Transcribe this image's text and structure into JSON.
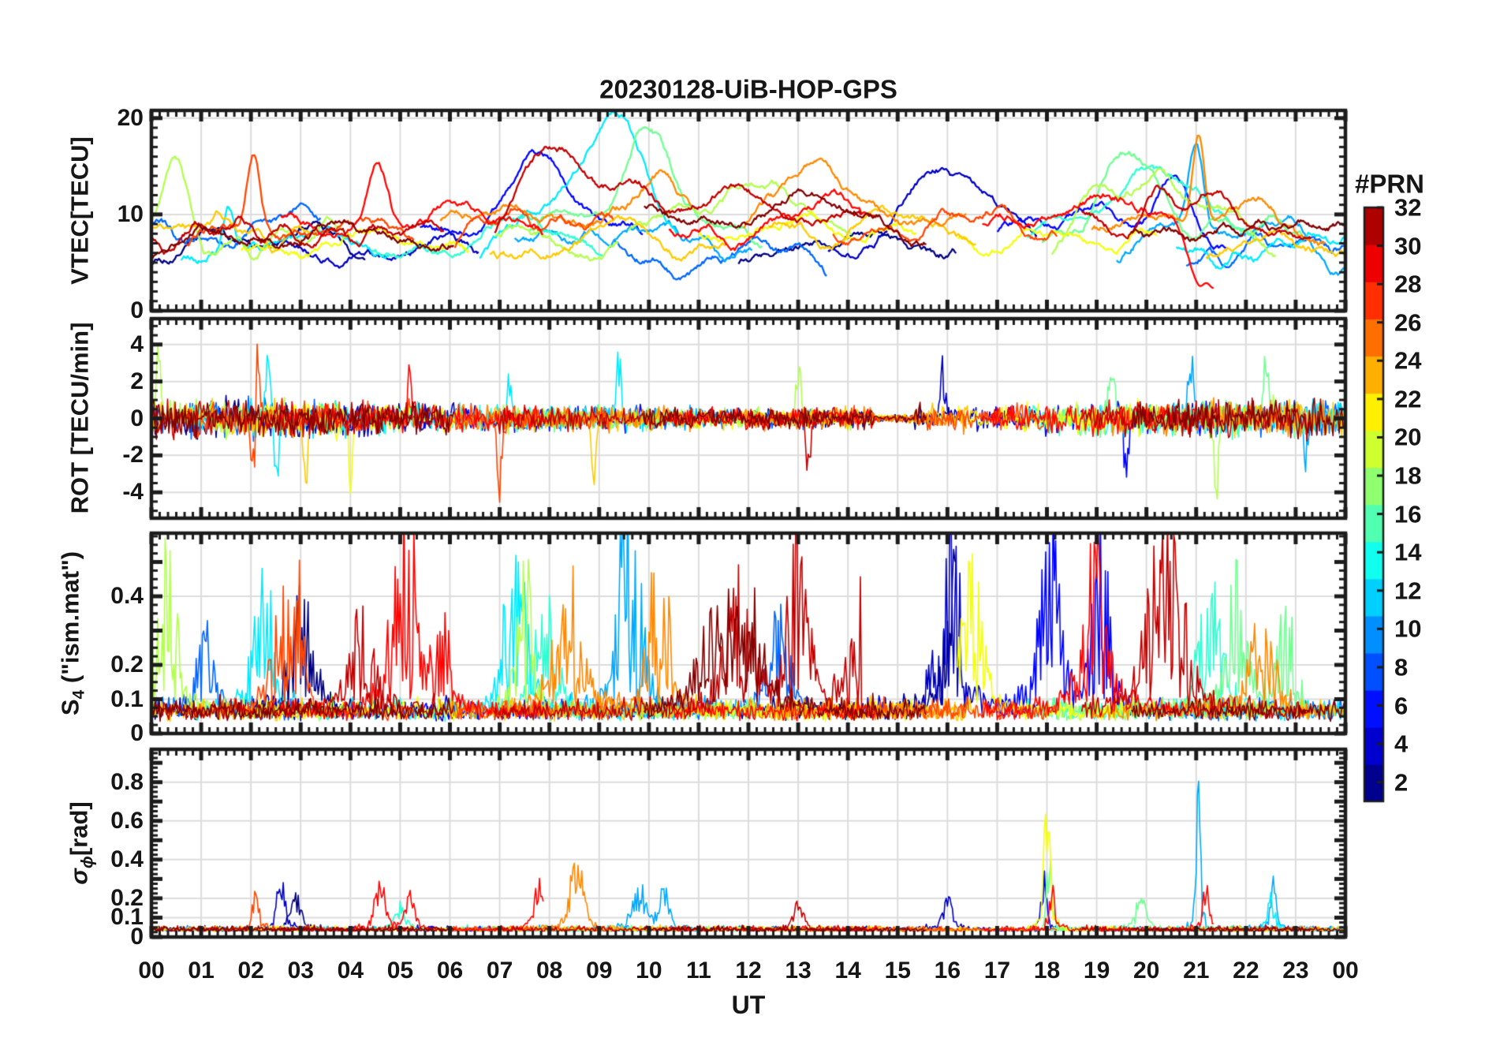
{
  "colorbar": {
    "title": "#PRN",
    "tick_values": [
      2,
      4,
      6,
      8,
      10,
      12,
      14,
      16,
      18,
      20,
      22,
      24,
      26,
      28,
      30,
      32
    ],
    "value_range": [
      1,
      32
    ],
    "segment_colors": [
      "#00008F",
      "#0000CF",
      "#0010FF",
      "#0050FF",
      "#008FFF",
      "#00CFFF",
      "#10FFEF",
      "#50FFAF",
      "#8FFF6F",
      "#CFFF2F",
      "#FFEF00",
      "#FFAF00",
      "#FF6F00",
      "#FF2F00",
      "#EF0000",
      "#AF0000"
    ]
  },
  "chart_data": {
    "type": "line",
    "title": "20230128-UiB-HOP-GPS",
    "xlabel": "UT",
    "colormap": "jet",
    "prn_range": [
      1,
      32
    ],
    "x": {
      "range_hours": [
        0,
        24
      ],
      "tick_values": [
        0,
        1,
        2,
        3,
        4,
        5,
        6,
        7,
        8,
        9,
        10,
        11,
        12,
        13,
        14,
        15,
        16,
        17,
        18,
        19,
        20,
        21,
        22,
        23,
        24
      ],
      "tick_labels": [
        "00",
        "01",
        "02",
        "03",
        "04",
        "05",
        "06",
        "07",
        "08",
        "09",
        "10",
        "11",
        "12",
        "13",
        "14",
        "15",
        "16",
        "17",
        "18",
        "19",
        "20",
        "21",
        "22",
        "23",
        "00"
      ],
      "grid": true,
      "minor_tick_minutes": 10
    },
    "panels": [
      {
        "name": "vtec",
        "ylabel": "VTEC[TECU]",
        "ylim": [
          0,
          20.8
        ],
        "yticks": [
          [
            0,
            "0"
          ],
          [
            10,
            "10"
          ],
          [
            20,
            "20"
          ]
        ],
        "grid_y": [
          10,
          20
        ],
        "minor_step": 1,
        "extra_major": []
      },
      {
        "name": "rot",
        "ylabel": "ROT [TECU/min]",
        "ylim": [
          -5.4,
          5.4
        ],
        "yticks": [
          [
            -4,
            "-4"
          ],
          [
            -2,
            "-2"
          ],
          [
            0,
            "0"
          ],
          [
            2,
            "2"
          ],
          [
            4,
            "4"
          ]
        ],
        "grid_y": [
          -4,
          -2,
          0,
          2,
          4
        ],
        "minor_step": 0.5,
        "extra_major": []
      },
      {
        "name": "s4",
        "ylabel": "S4 (\"ism.mat\")",
        "ylabel_parts": {
          "main": "S",
          "sub": "4",
          "rest": " (\"ism.mat\")"
        },
        "ylim": [
          0,
          0.584
        ],
        "yticks": [
          [
            0,
            "0"
          ],
          [
            0.1,
            "0.1"
          ],
          [
            0.2,
            "0.2"
          ],
          [
            0.4,
            "0.4"
          ]
        ],
        "grid_y": [
          0.1,
          0.2,
          0.4
        ],
        "minor_step": 0.025,
        "extra_major": [
          0.3,
          0.5
        ]
      },
      {
        "name": "sigma_phi",
        "ylabel": "σϕ[rad]",
        "ylabel_parts": {
          "sigma": "σ",
          "sub": "ϕ",
          "rest": "[rad]"
        },
        "ylim": [
          0,
          0.97
        ],
        "yticks": [
          [
            0,
            "0"
          ],
          [
            0.1,
            "0.1"
          ],
          [
            0.2,
            "0.2"
          ],
          [
            0.4,
            "0.4"
          ],
          [
            0.6,
            "0.6"
          ],
          [
            0.8,
            "0.8"
          ]
        ],
        "grid_y": [
          0.1,
          0.2,
          0.4,
          0.6,
          0.8
        ],
        "minor_step": 0.025,
        "extra_major": [
          0.3,
          0.5,
          0.7,
          0.9
        ]
      }
    ],
    "seed": 20230128,
    "passes_format": "[prn, t_start_h, t_end_h, vtec_base_TECU, vtec_arc_amp_TECU]",
    "passes": [
      [
        1,
        0,
        4.3,
        6.5,
        1.0
      ],
      [
        1,
        11.8,
        16.2,
        6.0,
        1.5
      ],
      [
        3,
        2.2,
        6.6,
        5.5,
        1.2
      ],
      [
        3,
        13.6,
        17.8,
        7.0,
        3.0
      ],
      [
        5,
        5.4,
        9.9,
        7.0,
        2.0
      ],
      [
        5,
        17.0,
        21.6,
        7.5,
        3.0
      ],
      [
        8,
        0,
        3.4,
        9.5,
        -1.5
      ],
      [
        8,
        9.3,
        13.6,
        5.5,
        1.0
      ],
      [
        8,
        20.8,
        24,
        6.0,
        0.5
      ],
      [
        10,
        7.3,
        12.1,
        6.5,
        1.5
      ],
      [
        10,
        19.4,
        24,
        7.0,
        1.5
      ],
      [
        12,
        0.6,
        4.8,
        6.0,
        1.0
      ],
      [
        12,
        6.6,
        10.6,
        7.0,
        3.0
      ],
      [
        12,
        20.6,
        24,
        6.5,
        0.8
      ],
      [
        14,
        4.4,
        9.1,
        6.0,
        2.0
      ],
      [
        14,
        17.6,
        22.2,
        7.0,
        3.5
      ],
      [
        16,
        7.6,
        12.3,
        8.0,
        3.0
      ],
      [
        16,
        17.9,
        23.2,
        7.5,
        3.0
      ],
      [
        18,
        0,
        3.9,
        7.0,
        1.5
      ],
      [
        18,
        6.9,
        9.4,
        6.5,
        1.0
      ],
      [
        18,
        9.6,
        14.1,
        8.0,
        3.0
      ],
      [
        18,
        18.1,
        22.6,
        8.0,
        3.0
      ],
      [
        20,
        1.8,
        6.4,
        6.0,
        1.2
      ],
      [
        20,
        11.0,
        15.4,
        7.5,
        1.5
      ],
      [
        20,
        16.2,
        20.2,
        7.0,
        1.0
      ],
      [
        22,
        0,
        3.3,
        7.5,
        0.8
      ],
      [
        22,
        6.8,
        11.6,
        6.0,
        1.5
      ],
      [
        22,
        12.4,
        16.6,
        8.0,
        1.2
      ],
      [
        22,
        21.2,
        24,
        7.0,
        0.5
      ],
      [
        24,
        5.8,
        10.9,
        8.0,
        3.0
      ],
      [
        24,
        11.9,
        16.4,
        8.5,
        2.0
      ],
      [
        24,
        18.9,
        23.6,
        8.0,
        2.5
      ],
      [
        26,
        0.7,
        5.3,
        7.0,
        1.5
      ],
      [
        26,
        6.1,
        9.3,
        7.5,
        2.0
      ],
      [
        26,
        13.7,
        18.2,
        8.0,
        1.5
      ],
      [
        28,
        2.6,
        7.9,
        8.0,
        2.0
      ],
      [
        28,
        10.4,
        14.6,
        8.5,
        1.5
      ],
      [
        28,
        16.7,
        21.35,
        9.0,
        2.0
      ],
      [
        30,
        0,
        5.9,
        7.5,
        1.0
      ],
      [
        30,
        6.9,
        14.3,
        9.0,
        3.0
      ],
      [
        30,
        18.7,
        23.3,
        8.0,
        2.5
      ],
      [
        32,
        0,
        6.1,
        7.0,
        1.2
      ],
      [
        32,
        9.9,
        15.6,
        9.0,
        2.0
      ],
      [
        32,
        19.7,
        24,
        8.0,
        1.0
      ]
    ],
    "events": {
      "vtec_peaks_format": "[prn, t_h, peak_TECU, gauss_width_h]",
      "vtec_peaks": [
        [
          22,
          0.2,
          10.0,
          0.3
        ],
        [
          18,
          0.45,
          16.0,
          0.25
        ],
        [
          12,
          1.55,
          10.5,
          0.1
        ],
        [
          26,
          2.05,
          15.8,
          0.12
        ],
        [
          28,
          4.55,
          16.5,
          0.2
        ],
        [
          5,
          7.7,
          17.5,
          0.5
        ],
        [
          30,
          8.3,
          17.8,
          0.45
        ],
        [
          12,
          9.45,
          21.5,
          0.55
        ],
        [
          16,
          9.95,
          17.5,
          0.4
        ],
        [
          24,
          10.3,
          13.2,
          0.35
        ],
        [
          18,
          12.0,
          13.5,
          0.7
        ],
        [
          24,
          13.3,
          13.8,
          0.4
        ],
        [
          3,
          15.8,
          14.5,
          0.45
        ],
        [
          16,
          19.75,
          17.0,
          0.45
        ],
        [
          14,
          19.9,
          15.5,
          0.4
        ],
        [
          18,
          20.15,
          16.2,
          0.35
        ],
        [
          30,
          20.25,
          13.5,
          0.3
        ],
        [
          5,
          20.5,
          14.0,
          0.3
        ],
        [
          10,
          21.0,
          17.5,
          0.15
        ],
        [
          24,
          21.05,
          20.3,
          0.12
        ]
      ],
      "vtec_drops_format": "[prn, t_h, level_TECU]",
      "vtec_drops": [
        [
          28,
          20.85,
          2.6
        ]
      ],
      "rot_spikes_format": "[prn, t_h, amp_TECU_per_min]",
      "rot_spikes": [
        [
          18,
          0.15,
          4.6
        ],
        [
          26,
          2.05,
          -5.2
        ],
        [
          26,
          2.12,
          4.8
        ],
        [
          12,
          2.35,
          4.6
        ],
        [
          12,
          2.5,
          -4.4
        ],
        [
          22,
          3.1,
          -4.0
        ],
        [
          20,
          4.0,
          -4.5
        ],
        [
          28,
          5.2,
          3.5
        ],
        [
          26,
          7.0,
          -5.0
        ],
        [
          12,
          7.2,
          3.8
        ],
        [
          22,
          8.9,
          -4.3
        ],
        [
          12,
          9.4,
          4.2
        ],
        [
          18,
          13.0,
          4.3
        ],
        [
          30,
          13.2,
          -3.8
        ],
        [
          3,
          15.9,
          3.5
        ],
        [
          10,
          17.6,
          4.0
        ],
        [
          16,
          19.3,
          4.5
        ],
        [
          5,
          19.6,
          -4.2
        ],
        [
          10,
          20.9,
          4.7
        ],
        [
          18,
          21.4,
          -4.6
        ],
        [
          16,
          22.4,
          4.4
        ],
        [
          10,
          23.2,
          -3.9
        ]
      ],
      "s4_bursts_format": "[prn, t_h, amp, gauss_width_h]",
      "s4_bursts": [
        [
          18,
          0.3,
          0.45,
          0.2
        ],
        [
          8,
          1.1,
          0.3,
          0.15
        ],
        [
          12,
          2.2,
          0.5,
          0.18
        ],
        [
          26,
          2.6,
          0.4,
          0.2
        ],
        [
          26,
          3.0,
          0.5,
          0.08
        ],
        [
          1,
          3.0,
          0.4,
          0.2
        ],
        [
          30,
          4.2,
          0.3,
          0.25
        ],
        [
          28,
          5.1,
          0.62,
          0.2
        ],
        [
          28,
          5.8,
          0.35,
          0.15
        ],
        [
          12,
          7.3,
          0.6,
          0.18
        ],
        [
          18,
          7.5,
          0.5,
          0.15
        ],
        [
          14,
          7.9,
          0.35,
          0.2
        ],
        [
          24,
          8.4,
          0.45,
          0.25
        ],
        [
          10,
          9.6,
          0.7,
          0.2
        ],
        [
          24,
          10.2,
          0.5,
          0.2
        ],
        [
          32,
          11.3,
          0.3,
          0.3
        ],
        [
          30,
          11.8,
          0.4,
          0.25
        ],
        [
          32,
          12.0,
          0.35,
          0.3
        ],
        [
          8,
          12.6,
          0.3,
          0.2
        ],
        [
          30,
          13.0,
          0.55,
          0.2
        ],
        [
          30,
          14.2,
          0.45,
          0.2
        ],
        [
          3,
          16.0,
          0.62,
          0.2
        ],
        [
          1,
          16.2,
          0.45,
          0.2
        ],
        [
          20,
          16.5,
          0.5,
          0.2
        ],
        [
          10,
          17.3,
          0.55,
          0.2
        ],
        [
          5,
          18.1,
          0.6,
          0.2
        ],
        [
          28,
          19.0,
          0.55,
          0.25
        ],
        [
          5,
          19.1,
          0.55,
          0.15
        ],
        [
          30,
          20.4,
          0.65,
          0.3
        ],
        [
          14,
          21.3,
          0.45,
          0.2
        ],
        [
          16,
          21.8,
          0.4,
          0.2
        ],
        [
          24,
          22.3,
          0.4,
          0.2
        ],
        [
          16,
          22.8,
          0.35,
          0.15
        ]
      ],
      "sigma_phi_spikes_format": "[prn, t_h, amp_rad, gauss_width_h]",
      "sigma_phi_spikes": [
        [
          1,
          2.9,
          0.2,
          0.1
        ],
        [
          3,
          2.6,
          0.28,
          0.08
        ],
        [
          26,
          2.1,
          0.25,
          0.06
        ],
        [
          28,
          4.6,
          0.3,
          0.1
        ],
        [
          14,
          5.0,
          0.15,
          0.1
        ],
        [
          28,
          5.2,
          0.25,
          0.08
        ],
        [
          28,
          7.8,
          0.3,
          0.1
        ],
        [
          24,
          8.55,
          0.42,
          0.12
        ],
        [
          10,
          9.8,
          0.28,
          0.12
        ],
        [
          10,
          10.3,
          0.25,
          0.1
        ],
        [
          30,
          13.0,
          0.15,
          0.1
        ],
        [
          3,
          16.0,
          0.18,
          0.1
        ],
        [
          5,
          17.95,
          0.3,
          0.05
        ],
        [
          20,
          18.0,
          0.9,
          0.05
        ],
        [
          16,
          18.05,
          0.47,
          0.05
        ],
        [
          28,
          18.1,
          0.25,
          0.06
        ],
        [
          16,
          19.9,
          0.2,
          0.1
        ],
        [
          10,
          21.05,
          0.92,
          0.04
        ],
        [
          28,
          21.2,
          0.3,
          0.06
        ],
        [
          12,
          22.5,
          0.25,
          0.06
        ],
        [
          10,
          22.55,
          0.33,
          0.05
        ]
      ]
    }
  }
}
